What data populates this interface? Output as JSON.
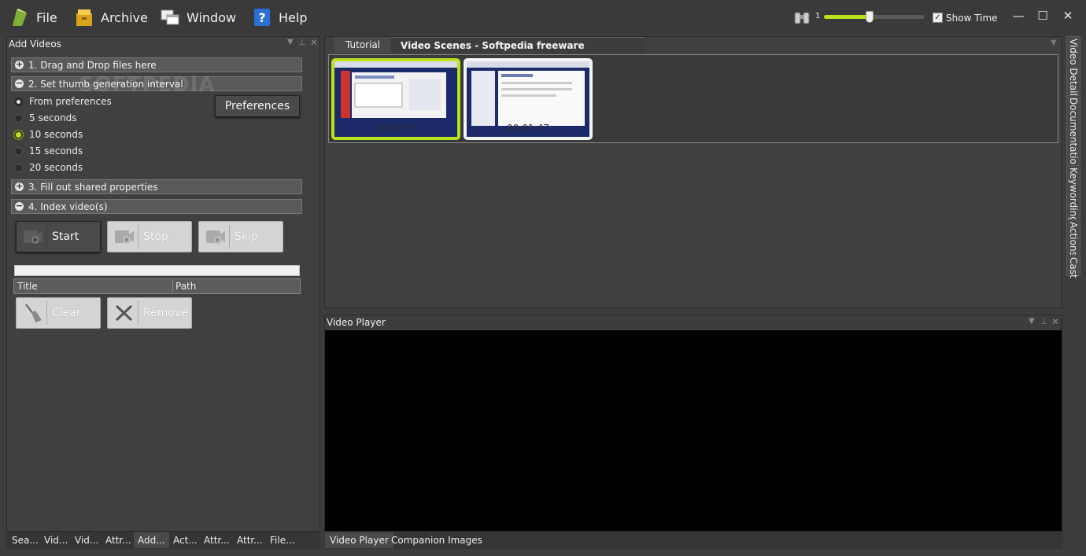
{
  "menu": {
    "file": "File",
    "archive": "Archive",
    "window": "Window",
    "help": "Help"
  },
  "toolbar": {
    "zoom_value": "1",
    "zoom_level": 0.45,
    "show_time_label": "Show Time",
    "show_time_checked": true
  },
  "window_controls": {
    "minimize": "—",
    "maximize": "☐",
    "close": "✕"
  },
  "add_videos": {
    "title": "Add Videos",
    "watermark": "SOFTPEDIA",
    "step1": "1. Drag and Drop files here",
    "step2": "2. Set thumb generation interval",
    "step3": "3. Fill out shared properties",
    "step4": "4. Index video(s)",
    "intervals": [
      "From preferences",
      "5 seconds",
      "10 seconds",
      "15 seconds",
      "20 seconds"
    ],
    "preferences_button": "Preferences",
    "start": "Start",
    "stop": "Stop",
    "skip": "Skip",
    "col_title": "Title",
    "col_path": "Path",
    "clear": "Clear",
    "remove": "Remove"
  },
  "bottom_tabs_left": [
    "Sea...",
    "Vid...",
    "Vid...",
    "Attr...",
    "Add...",
    "Act...",
    "Attr...",
    "Attr...",
    "File..."
  ],
  "doc_tabs": {
    "tutorial": "Tutorial",
    "video_scenes": "Video Scenes - Softpedia freeware downloads.wmv"
  },
  "scenes": [
    {
      "time": "00:00:53",
      "selected": true
    },
    {
      "time": "00:01:47",
      "selected": false
    }
  ],
  "video_player": {
    "title": "Video Player"
  },
  "bottom_tabs_right": [
    "Video Player",
    "Companion Images"
  ],
  "side_tabs": [
    "Video Details",
    "Documentation",
    "Keywording",
    "Actions",
    "Cast"
  ],
  "colors": {
    "accent_green": "#b7e21d",
    "background": "#3d3d3d",
    "player": "#000000"
  }
}
